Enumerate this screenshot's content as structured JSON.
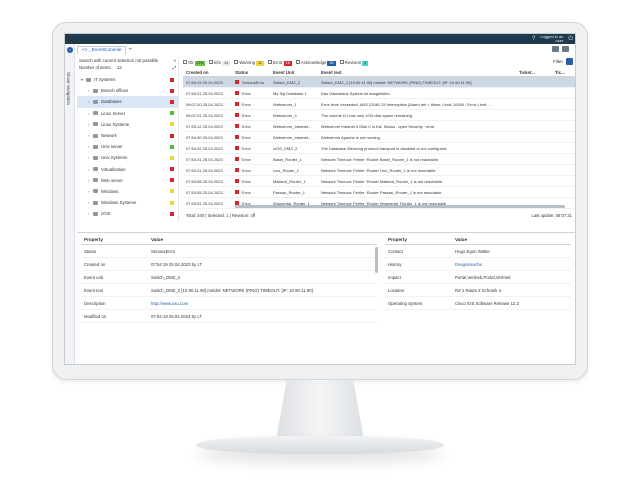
{
  "topbar": {
    "user_line1": "Logged in as",
    "user_line2": "user"
  },
  "sidenav": {
    "label": "Show navigation"
  },
  "tabs": [
    {
      "label": "<> _EventConsole"
    }
  ],
  "left": {
    "search_label": "Search with current selection not possible",
    "count_label": "Number of items:",
    "count_value": "13",
    "tree": [
      {
        "label": "IT Systems",
        "status": "red",
        "level": 0,
        "selected": false
      },
      {
        "label": "Branch offices",
        "status": "red",
        "level": 1,
        "selected": false
      },
      {
        "label": "Databases",
        "status": "red",
        "level": 1,
        "selected": true
      },
      {
        "label": "Linux Server",
        "status": "green",
        "level": 1,
        "selected": false
      },
      {
        "label": "Linux Systeme",
        "status": "yellow",
        "level": 1,
        "selected": false
      },
      {
        "label": "Network",
        "status": "red",
        "level": 1,
        "selected": false
      },
      {
        "label": "Unix server",
        "status": "green",
        "level": 1,
        "selected": false
      },
      {
        "label": "Unix Systeme",
        "status": "yellow",
        "level": 1,
        "selected": false
      },
      {
        "label": "Virtualization",
        "status": "red",
        "level": 1,
        "selected": false
      },
      {
        "label": "Web server",
        "status": "red",
        "level": 1,
        "selected": false
      },
      {
        "label": "Windows",
        "status": "yellow",
        "level": 1,
        "selected": false
      },
      {
        "label": "Windows Systeme",
        "status": "yellow",
        "level": 1,
        "selected": false
      },
      {
        "label": "z/OS",
        "status": "red",
        "level": 1,
        "selected": false
      }
    ]
  },
  "filters": [
    {
      "label": "Ok",
      "count": "376",
      "color": "#6cc24a"
    },
    {
      "label": "Info",
      "count": "14",
      "color": "#e9e9e9"
    },
    {
      "label": "Warning",
      "count": "11",
      "color": "#f2d53c"
    },
    {
      "label": "Error",
      "count": "16",
      "color": "#d8262c"
    },
    {
      "label": "Acknowledge",
      "count": "16",
      "color": "#1f5fb0"
    },
    {
      "label": "Revision",
      "count": "0",
      "color": "#4fd0d9"
    }
  ],
  "filter_label": "Filter",
  "grid": {
    "headers": [
      "Created on",
      "Status",
      "Event Unit",
      "Event text",
      "Ticket...",
      "Tic..."
    ],
    "rows": [
      {
        "created": "07:54:19 25.04.2023",
        "status": "SeriousError",
        "unit": "Switch_DMZ_2",
        "text": "Switch_DMZ_2 [10.90.11.90] meldet: NETWORK (PING) TIMEOUT. [IP: 10.90.11.90]",
        "selected": true
      },
      {
        "created": "07:54:31 25.04.2023",
        "status": "Error",
        "unit": "My Sql Database 1",
        "text": "Das Datenbank System ist ausgefallen.",
        "selected": false
      },
      {
        "created": "08:07:20 25.04.2023",
        "status": "Error",
        "unit": "Webserver_1",
        "text": "Error level exceeded. AHS 22081 29 Interruption [Alarm bei > Warn: Limit: 10000 / Error Limit: ...",
        "selected": false
      },
      {
        "created": "08:07:01 25.04.2023",
        "status": "Error",
        "unit": "Webserver_4",
        "text": "The volume D:\\ has only 10% disk space remaining.",
        "selected": false
      },
      {
        "created": "07:53:12 25.04.2023",
        "status": "Error",
        "unit": "Webserver_Intranet...",
        "text": "Webserver Intranet 3 Disk C is full. Status : open Severity : error",
        "selected": false
      },
      {
        "created": "07:54:30 25.04.2023",
        "status": "Error",
        "unit": "Webserver_Intranet...",
        "text": "Webserver Apache is not running",
        "selected": false
      },
      {
        "created": "07:54:32 25.04.2023",
        "status": "Error",
        "unit": "z/OS_DMZ_2",
        "text": "The Database Mirroring protocol transport is disabled or not configured.",
        "selected": false
      },
      {
        "created": "07:54:31 25.04.2023",
        "status": "Error",
        "unit": "Basel_Router_1",
        "text": "Network Timeout: Fehler: Router Basel_Router_1 is not reachable.",
        "selected": false
      },
      {
        "created": "07:54:31 25.04.2023",
        "status": "Error",
        "unit": "Linz_Router_1",
        "text": "Network Timeout: Fehler: Router Linz_Router_1 is not reachable.",
        "selected": false
      },
      {
        "created": "07:53:58 25.04.2023",
        "status": "Error",
        "unit": "Mailand_Router_1",
        "text": "Network Timeout: Fehler: Router Mailand_Router_1 is not reachable.",
        "selected": false
      },
      {
        "created": "07:53:55 25.04.2023",
        "status": "Error",
        "unit": "Passau_Router_1",
        "text": "Network Timeout: Fehler: Router Passau_Router_1 is not reachable.",
        "selected": false
      },
      {
        "created": "07:53:51 25.04.2023",
        "status": "Error",
        "unit": "Wuppertal_Router_1",
        "text": "Network Timeout: Fehler: Router Wuppertal_Router_1 is not reachable.",
        "selected": false
      }
    ],
    "footer_left": "Total: 340 | Selected: 1 | Revision: off",
    "footer_right": "Last update: 08:07:21"
  },
  "props_left": {
    "headers": [
      "Property",
      "Value"
    ],
    "rows": [
      {
        "key": "Status",
        "value": "SeriousError",
        "link": false
      },
      {
        "key": "Created on",
        "value": "07:54:19 25.04.2023 by LT",
        "link": false
      },
      {
        "key": "Event unit",
        "value": "Switch_DMZ_2",
        "link": false
      },
      {
        "key": "Event text",
        "value": "Switch_DMZ_2 [10.90.11.90] meldet: NETWORK (PING) TIMEOUT. [IP: 10.90.11.90]",
        "link": false
      },
      {
        "key": "Description",
        "value": "http://www.usu.com",
        "link": true
      },
      {
        "key": "Modified on",
        "value": "07:54:19 25.04.2023 by LT",
        "link": false
      }
    ]
  },
  "props_right": {
    "headers": [
      "Property",
      "Value"
    ],
    "rows": [
      {
        "key": "Contact",
        "value": "Hugo Egon Walter",
        "link": false
      },
      {
        "key": "History",
        "value": "Ereignissuche",
        "link": true
      },
      {
        "key": "Impact",
        "value": "Portal,Vertrieb,Portal,Vertrieb",
        "link": false
      },
      {
        "key": "Location",
        "value": "RZ 1 Raum 2 Schrank 4",
        "link": false
      },
      {
        "key": "Operating System",
        "value": "Cisco IOS Software Release 12.2",
        "link": false
      }
    ]
  }
}
